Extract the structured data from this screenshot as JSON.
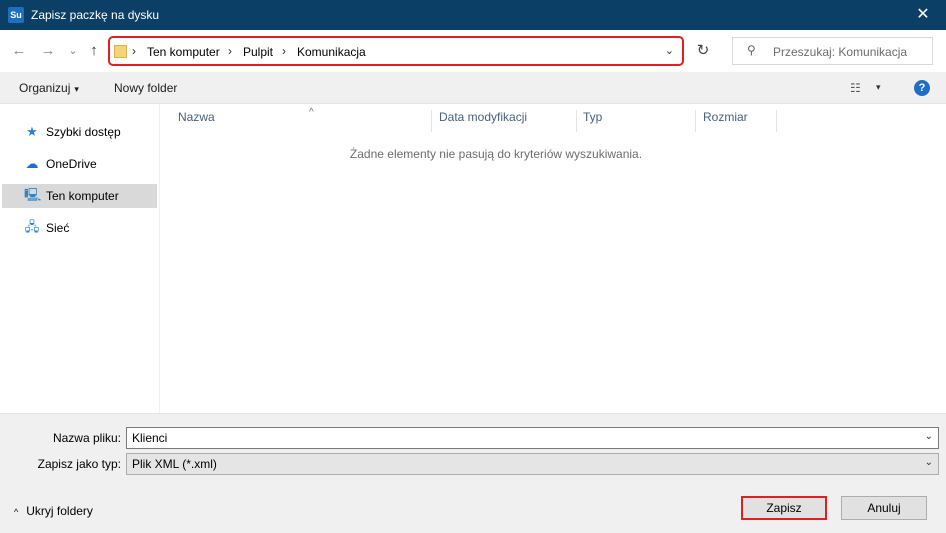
{
  "window": {
    "title": "Zapisz paczkę na dysku",
    "app_icon_text": "Su",
    "close_glyph": "✕"
  },
  "nav": {
    "back_glyph": "←",
    "forward_glyph": "→",
    "recent_glyph": "⌄",
    "up_glyph": "↑",
    "breadcrumbs": [
      "Ten komputer",
      "Pulpit",
      "Komunikacja"
    ],
    "separator": "›",
    "dropdown_glyph": "⌄",
    "refresh_glyph": "↻",
    "search_placeholder": "Przeszukaj: Komunikacja",
    "search_glyph": "⚲"
  },
  "toolbar": {
    "organize_label": "Organizuj",
    "organize_caret": "▾",
    "new_folder_label": "Nowy folder",
    "view_glyph": "☷",
    "view_caret": "▾",
    "help_glyph": "?"
  },
  "sidebar": {
    "items": [
      {
        "label": "Szybki dostęp",
        "icon": "star-icon",
        "glyph": "★",
        "color": "#2b7fd7"
      },
      {
        "label": "OneDrive",
        "icon": "cloud-icon",
        "glyph": "☁",
        "color": "#1b6fc8"
      },
      {
        "label": "Ten komputer",
        "icon": "computer-icon",
        "glyph": "🖳",
        "color": "#2b86c9",
        "selected": true
      },
      {
        "label": "Sieć",
        "icon": "network-icon",
        "glyph": "🖧",
        "color": "#2b86c9"
      }
    ]
  },
  "content": {
    "columns": [
      "Nazwa",
      "Data modyfikacji",
      "Typ",
      "Rozmiar"
    ],
    "sort_glyph": "^",
    "empty_message": "Żadne elementy nie pasują do kryteriów wyszukiwania."
  },
  "form": {
    "filename_label": "Nazwa pliku:",
    "filename_value": "Klienci",
    "filetype_label": "Zapisz jako typ:",
    "filetype_value": "Plik XML (*.xml)",
    "dropdown_glyph": "⌄"
  },
  "footer": {
    "hide_folders_label": "Ukryj foldery",
    "hide_caret": "^",
    "save_label": "Zapisz",
    "cancel_label": "Anuluj"
  },
  "colors": {
    "titlebar": "#0c3f66",
    "highlight": "#e02020",
    "accent": "#1e6fc2"
  }
}
